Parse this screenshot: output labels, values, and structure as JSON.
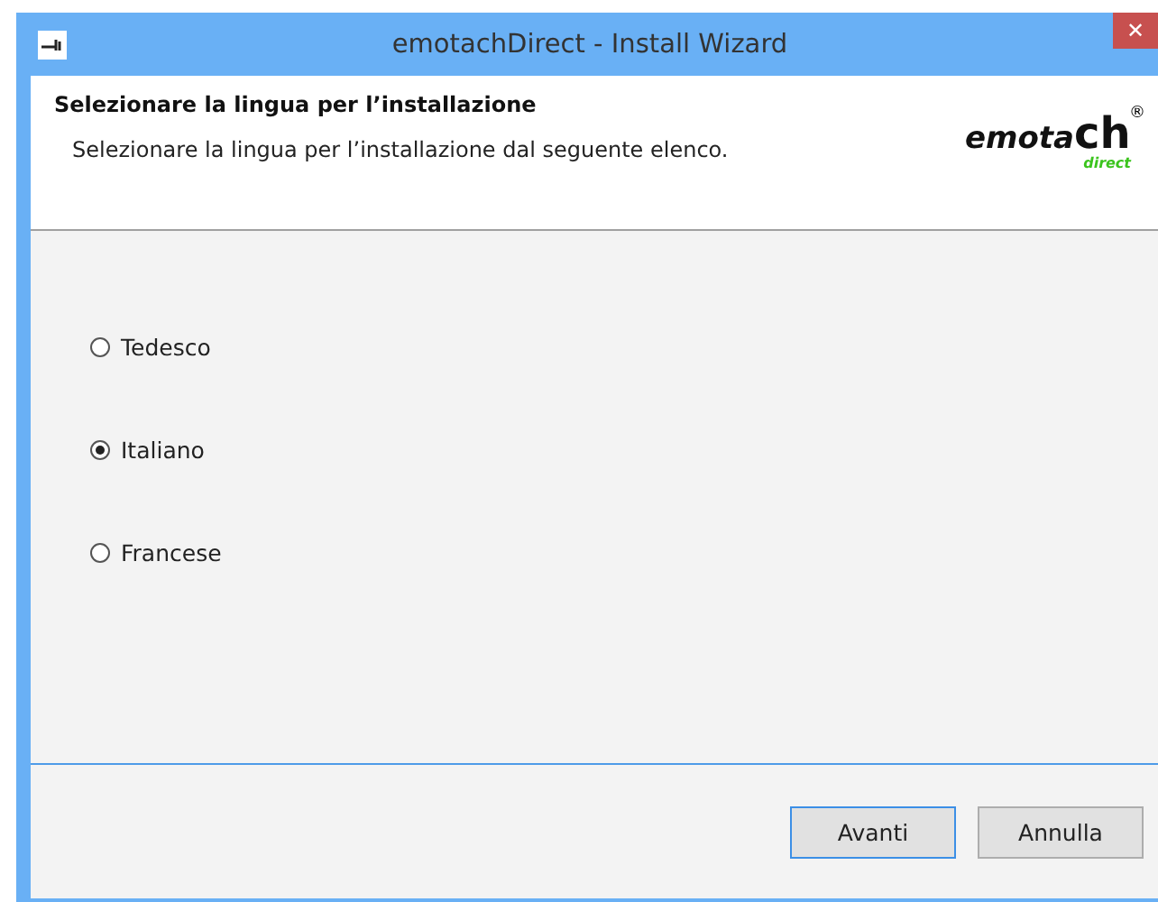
{
  "window": {
    "title": "emotachDirect - Install Wizard",
    "close": "✕"
  },
  "header": {
    "title": "Selezionare la lingua per l’installazione",
    "subtitle": "Selezionare la lingua per l’installazione dal seguente elenco.",
    "logo": {
      "main": "emota",
      "big": "ch",
      "mark": "®",
      "sub": "direct"
    }
  },
  "options": [
    {
      "label": "Tedesco",
      "selected": false
    },
    {
      "label": "Italiano",
      "selected": true
    },
    {
      "label": "Francese",
      "selected": false
    }
  ],
  "buttons": [
    {
      "label": "Avanti",
      "focused": true
    },
    {
      "label": "Annulla",
      "focused": false
    }
  ]
}
